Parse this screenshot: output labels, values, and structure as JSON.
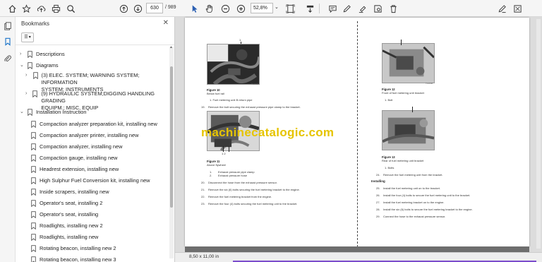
{
  "toolbar": {
    "page_current": "630",
    "page_total": "/ 989",
    "zoom": "52,8%",
    "icons": [
      "home-icon",
      "star-icon",
      "upload-icon",
      "print-icon",
      "zoom-search-icon",
      "prev-page-icon",
      "next-page-icon",
      "select-cursor-icon",
      "hand-icon",
      "zoom-out-icon",
      "zoom-in-icon",
      "fit-page-icon",
      "scroll-mode-icon",
      "comment-icon",
      "pen-icon",
      "highlight-icon",
      "stamp-icon",
      "delete-icon",
      "sign-icon",
      "share-icon"
    ]
  },
  "sidebar": {
    "title": "Bookmarks",
    "items": [
      {
        "label": "Descriptions",
        "chevron": "›",
        "indent": 0
      },
      {
        "label": "Diagrams",
        "chevron": "⌄",
        "indent": 0
      },
      {
        "label": "(3) ELEC. SYSTEM; WARNING SYSTEM; INFORMATION",
        "label2": "SYSTEM; INSTRUMENTS",
        "chevron": "›",
        "indent": 1
      },
      {
        "label": "(9) HYDRAULIC SYSTEM;DIGGING HANDLING GRADING",
        "label2": "EQUIPM.; MISC. EQUIP",
        "chevron": "›",
        "indent": 1
      },
      {
        "label": "Installation Instruction",
        "chevron": "⌄",
        "indent": 0
      },
      {
        "label": "Compaction analyzer preparation kit, installing new",
        "indent": 2
      },
      {
        "label": "Compaction analyzer printer, installing new",
        "indent": 2
      },
      {
        "label": "Compaction analyzer, installing new",
        "indent": 2
      },
      {
        "label": "Compaction gauge, installing new",
        "indent": 2
      },
      {
        "label": "Headrest extension, installing new",
        "indent": 2
      },
      {
        "label": "High Sulphur Fuel Conversion kit, installing new",
        "indent": 2
      },
      {
        "label": "Inside scrapers, installing new",
        "indent": 2
      },
      {
        "label": "Operator's seat, installing 2",
        "indent": 2
      },
      {
        "label": "Operator's seat, installing",
        "indent": 2
      },
      {
        "label": "Roadlights, installing new 2",
        "indent": 2
      },
      {
        "label": "Roadlights, installing new",
        "indent": 2
      },
      {
        "label": "Rotating beacon, installing new 2",
        "indent": 2
      },
      {
        "label": "Rotating beacon, installing new 3",
        "indent": 2
      }
    ]
  },
  "document": {
    "left": {
      "fig10_callout": "1",
      "fig10_title": "Figure 10",
      "fig10_subtitle": "Below fuel rail",
      "fig10_legend": "1.       Fuel metering unit B return pipe",
      "step19": "Remove the bolt securing the exhaust pressure pipe clamp to the bracket.",
      "fig11_callouts": "1   2",
      "fig11_title": "Figure 11",
      "fig11_subtitle": "Above flywheel",
      "fig11_legend1": "Exhaust pressure pipe clamp",
      "fig11_legend2": "Exhaust pressure hose",
      "step20": "Disconnect the hose from the exhaust pressure sensor.",
      "step21": "Remove the six (6) bolts securing the fuel metering bracket to the engine.",
      "step22": "Remove the fuel metering bracket from the engine.",
      "step23": "Remove the four (4) bolts securing the fuel metering unit to the bracket."
    },
    "right": {
      "fig12_title": "Figure 12",
      "fig12_subtitle": "Front of fuel metering unit bracket",
      "fig12_legend": "1.       Bolt",
      "fig13_title": "Figure 13",
      "fig13_subtitle": "Rear of fuel metering unit bracket",
      "fig13_legend": "1.       Bolts",
      "step24": "Remove the fuel metering unit from the bracket.",
      "installing": "Installing",
      "step25": "Install the fuel metering unit on to the bracket.",
      "step26": "Install the four (4) bolts to secure the fuel metering unit to the bracket.",
      "step27": "Install the fuel metering bracket on to the engine.",
      "step28": "Install the six (6) bolts to secure the fuel metering bracket to the engine.",
      "step29": "Connect the hose to the exhaust pressure sensor."
    },
    "watermark": "machinecatalogic.com"
  },
  "status": {
    "page_size": "8,50 x 11,00 in"
  },
  "colors": {
    "accent": "#1a73c8",
    "watermark": "#e6c400",
    "scroll": "#7c4dcc"
  }
}
